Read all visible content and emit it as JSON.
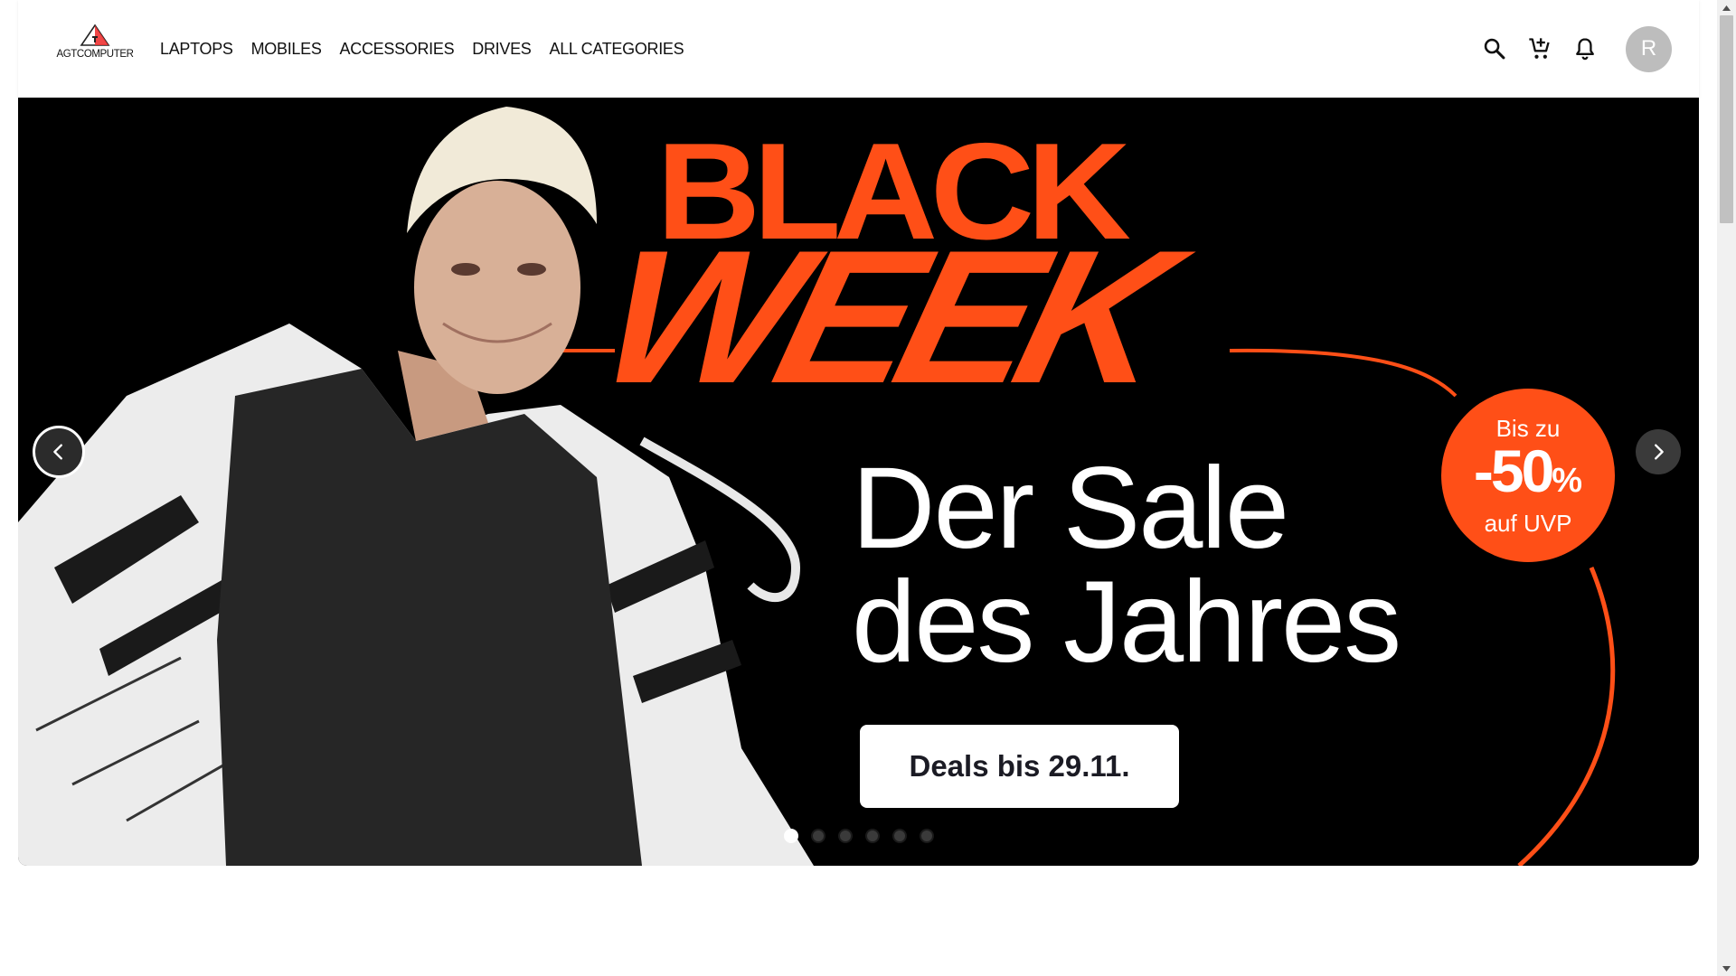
{
  "header": {
    "logo_text": "AGTCOMPUTER",
    "nav": [
      {
        "label": "LAPTOPS"
      },
      {
        "label": "MOBILES"
      },
      {
        "label": "ACCESSORIES"
      },
      {
        "label": "DRIVES"
      },
      {
        "label": "ALL CATEGORIES"
      }
    ],
    "icons": [
      "search-icon",
      "add-shopping-cart-icon",
      "notifications-bell-icon"
    ],
    "avatar_initial": "R"
  },
  "hero": {
    "title_line1": "BLACK",
    "title_line2": "WEEK",
    "headline_line1": "Der Sale",
    "headline_line2": "des Jahres",
    "badge": {
      "top": "Bis zu",
      "value": "-50",
      "unit": "%",
      "bottom": "auf UVP"
    },
    "cta_label": "Deals bis 29.11.",
    "slide_count": 6,
    "active_slide": 1
  },
  "colors": {
    "accent_orange": "#ff4f17",
    "banner_background": "#000000",
    "navbar_background": "#ffffff",
    "avatar_background": "#bdbdbd"
  }
}
